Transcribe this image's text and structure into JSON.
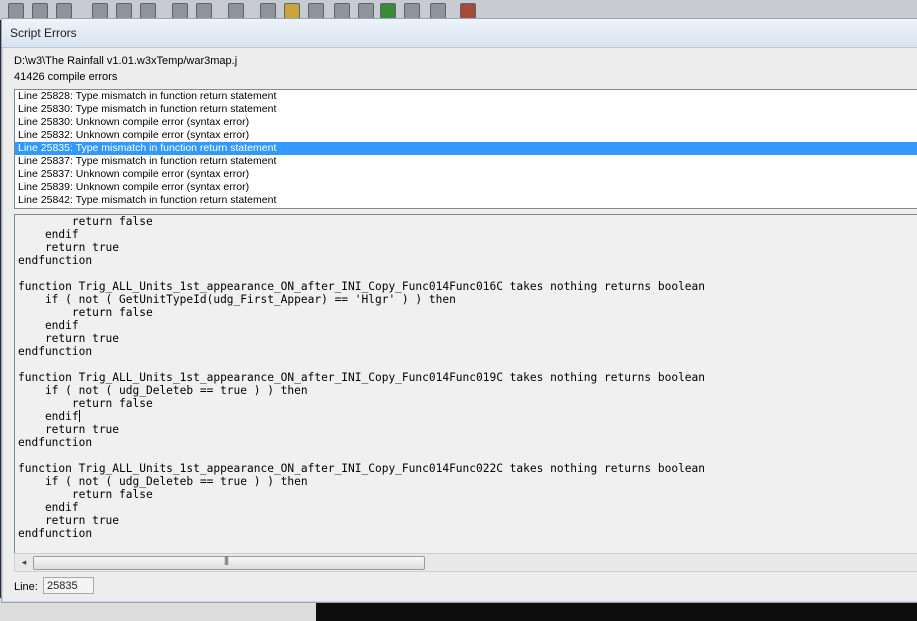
{
  "window": {
    "title": "Script Errors"
  },
  "file_path": "D:\\w3\\The Rainfall v1.01.w3xTemp/war3map.j",
  "error_count": "41426 compile errors",
  "errors": [
    {
      "text": "Line 25828: Type mismatch in function return statement",
      "selected": false
    },
    {
      "text": "Line 25830: Type mismatch in function return statement",
      "selected": false
    },
    {
      "text": "Line 25830: Unknown compile error (syntax error)",
      "selected": false
    },
    {
      "text": "Line 25832: Unknown compile error (syntax error)",
      "selected": false
    },
    {
      "text": "Line 25835: Type mismatch in function return statement",
      "selected": true
    },
    {
      "text": "Line 25837: Type mismatch in function return statement",
      "selected": false
    },
    {
      "text": "Line 25837: Unknown compile error (syntax error)",
      "selected": false
    },
    {
      "text": "Line 25839: Unknown compile error (syntax error)",
      "selected": false
    },
    {
      "text": "Line 25842: Type mismatch in function return statement",
      "selected": false
    }
  ],
  "code_lines": [
    "        return false",
    "    endif",
    "    return true",
    "endfunction",
    "",
    "function Trig_ALL_Units_1st_appearance_ON_after_INI_Copy_Func014Func016C takes nothing returns boolean",
    "    if ( not ( GetUnitTypeId(udg_First_Appear) == 'Hlgr' ) ) then",
    "        return false",
    "    endif",
    "    return true",
    "endfunction",
    "",
    "function Trig_ALL_Units_1st_appearance_ON_after_INI_Copy_Func014Func019C takes nothing returns boolean",
    "    if ( not ( udg_Deleteb == true ) ) then",
    "        return false",
    "    endif",
    "    return true",
    "endfunction",
    "",
    "function Trig_ALL_Units_1st_appearance_ON_after_INI_Copy_Func014Func022C takes nothing returns boolean",
    "    if ( not ( udg_Deleteb == true ) ) then",
    "        return false",
    "    endif",
    "    return true",
    "endfunction"
  ],
  "caret_line_index": 15,
  "scrollbar": {
    "left_arrow": "◂",
    "grip": "|||"
  },
  "line_field": {
    "label": "Line:",
    "value": "25835"
  },
  "colors": {
    "selection": "#3399ff",
    "dialog_bg": "#ededed",
    "code_bg": "#f0f0f0"
  }
}
